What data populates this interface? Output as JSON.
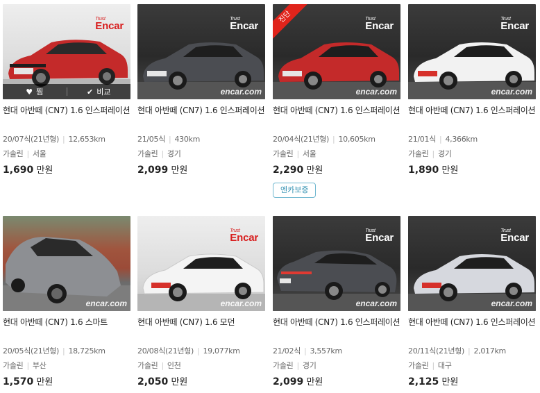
{
  "brand_watermark": "encar.com",
  "logo_small": "Trust",
  "logo_text": "Encar",
  "overlay": {
    "like_label": "찜",
    "compare_label": "비교"
  },
  "cards": [
    {
      "title": "현대 아반떼 (CN7) 1.6 인스퍼레이션",
      "year": "20/07식(21년형)",
      "mileage": "12,653km",
      "fuel": "가솔린",
      "region": "서울",
      "price": "1,690",
      "unit": "만원",
      "car_color": "#c42a2a"
    },
    {
      "title": "현대 아반떼 (CN7) 1.6 인스퍼레이션",
      "year": "21/05식",
      "mileage": "430km",
      "fuel": "가솔린",
      "region": "경기",
      "price": "2,099",
      "unit": "만원",
      "car_color": "#4b4d52"
    },
    {
      "title": "현대 아반떼 (CN7) 1.6 인스퍼레이션",
      "year": "20/04식(21년형)",
      "mileage": "10,605km",
      "fuel": "가솔린",
      "region": "서울",
      "price": "2,290",
      "unit": "만원",
      "car_color": "#c42a2a",
      "ribbon": "진단",
      "badge": "엔카보증"
    },
    {
      "title": "현대 아반떼 (CN7) 1.6 인스퍼레이션",
      "year": "21/01식",
      "mileage": "4,366km",
      "fuel": "가솔린",
      "region": "경기",
      "price": "1,890",
      "unit": "만원",
      "car_color": "#f2f2f2"
    },
    {
      "title": "현대 아반떼 (CN7) 1.6 스마트",
      "year": "20/05식(21년형)",
      "mileage": "18,725km",
      "fuel": "가솔린",
      "region": "부산",
      "price": "1,570",
      "unit": "만원",
      "car_color": "#8d8f93"
    },
    {
      "title": "현대 아반떼 (CN7) 1.6 모던",
      "year": "20/08식(21년형)",
      "mileage": "19,077km",
      "fuel": "가솔린",
      "region": "인천",
      "price": "2,050",
      "unit": "만원",
      "car_color": "#f4f4f4"
    },
    {
      "title": "현대 아반떼 (CN7) 1.6 인스퍼레이션",
      "year": "21/02식",
      "mileage": "3,557km",
      "fuel": "가솔린",
      "region": "경기",
      "price": "2,099",
      "unit": "만원",
      "car_color": "#4b4d52"
    },
    {
      "title": "현대 아반떼 (CN7) 1.6 인스퍼레이션",
      "year": "20/11식(21년형)",
      "mileage": "2,017km",
      "fuel": "가솔린",
      "region": "대구",
      "price": "2,125",
      "unit": "만원",
      "car_color": "#d6d8de"
    }
  ]
}
